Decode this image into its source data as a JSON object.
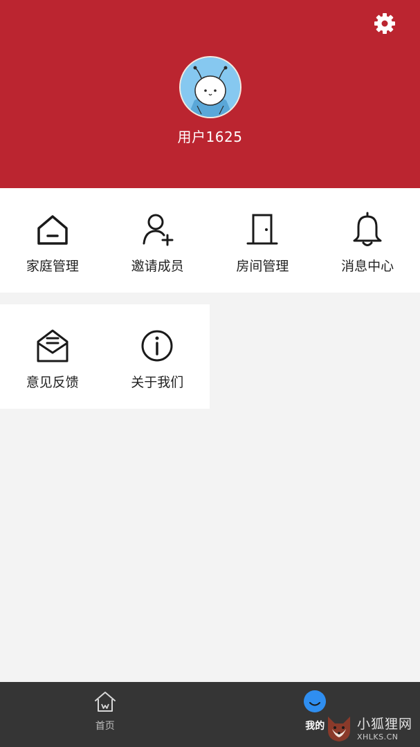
{
  "header": {
    "username": "用户1625",
    "background_color": "#bb2530"
  },
  "menu": {
    "row1": [
      {
        "label": "家庭管理",
        "icon": "home-icon"
      },
      {
        "label": "邀请成员",
        "icon": "add-user-icon"
      },
      {
        "label": "房间管理",
        "icon": "door-icon"
      },
      {
        "label": "消息中心",
        "icon": "bell-icon"
      }
    ],
    "row2": [
      {
        "label": "意见反馈",
        "icon": "mail-icon"
      },
      {
        "label": "关于我们",
        "icon": "info-icon"
      }
    ]
  },
  "tabbar": {
    "tabs": [
      {
        "label": "首页",
        "icon": "home-outline-icon",
        "active": false
      },
      {
        "label": "我的",
        "icon": "smile-face-icon",
        "active": true
      }
    ],
    "active_color": "#2f8ef0"
  },
  "watermark": {
    "title": "小狐狸网",
    "url": "XHLKS.CN"
  }
}
